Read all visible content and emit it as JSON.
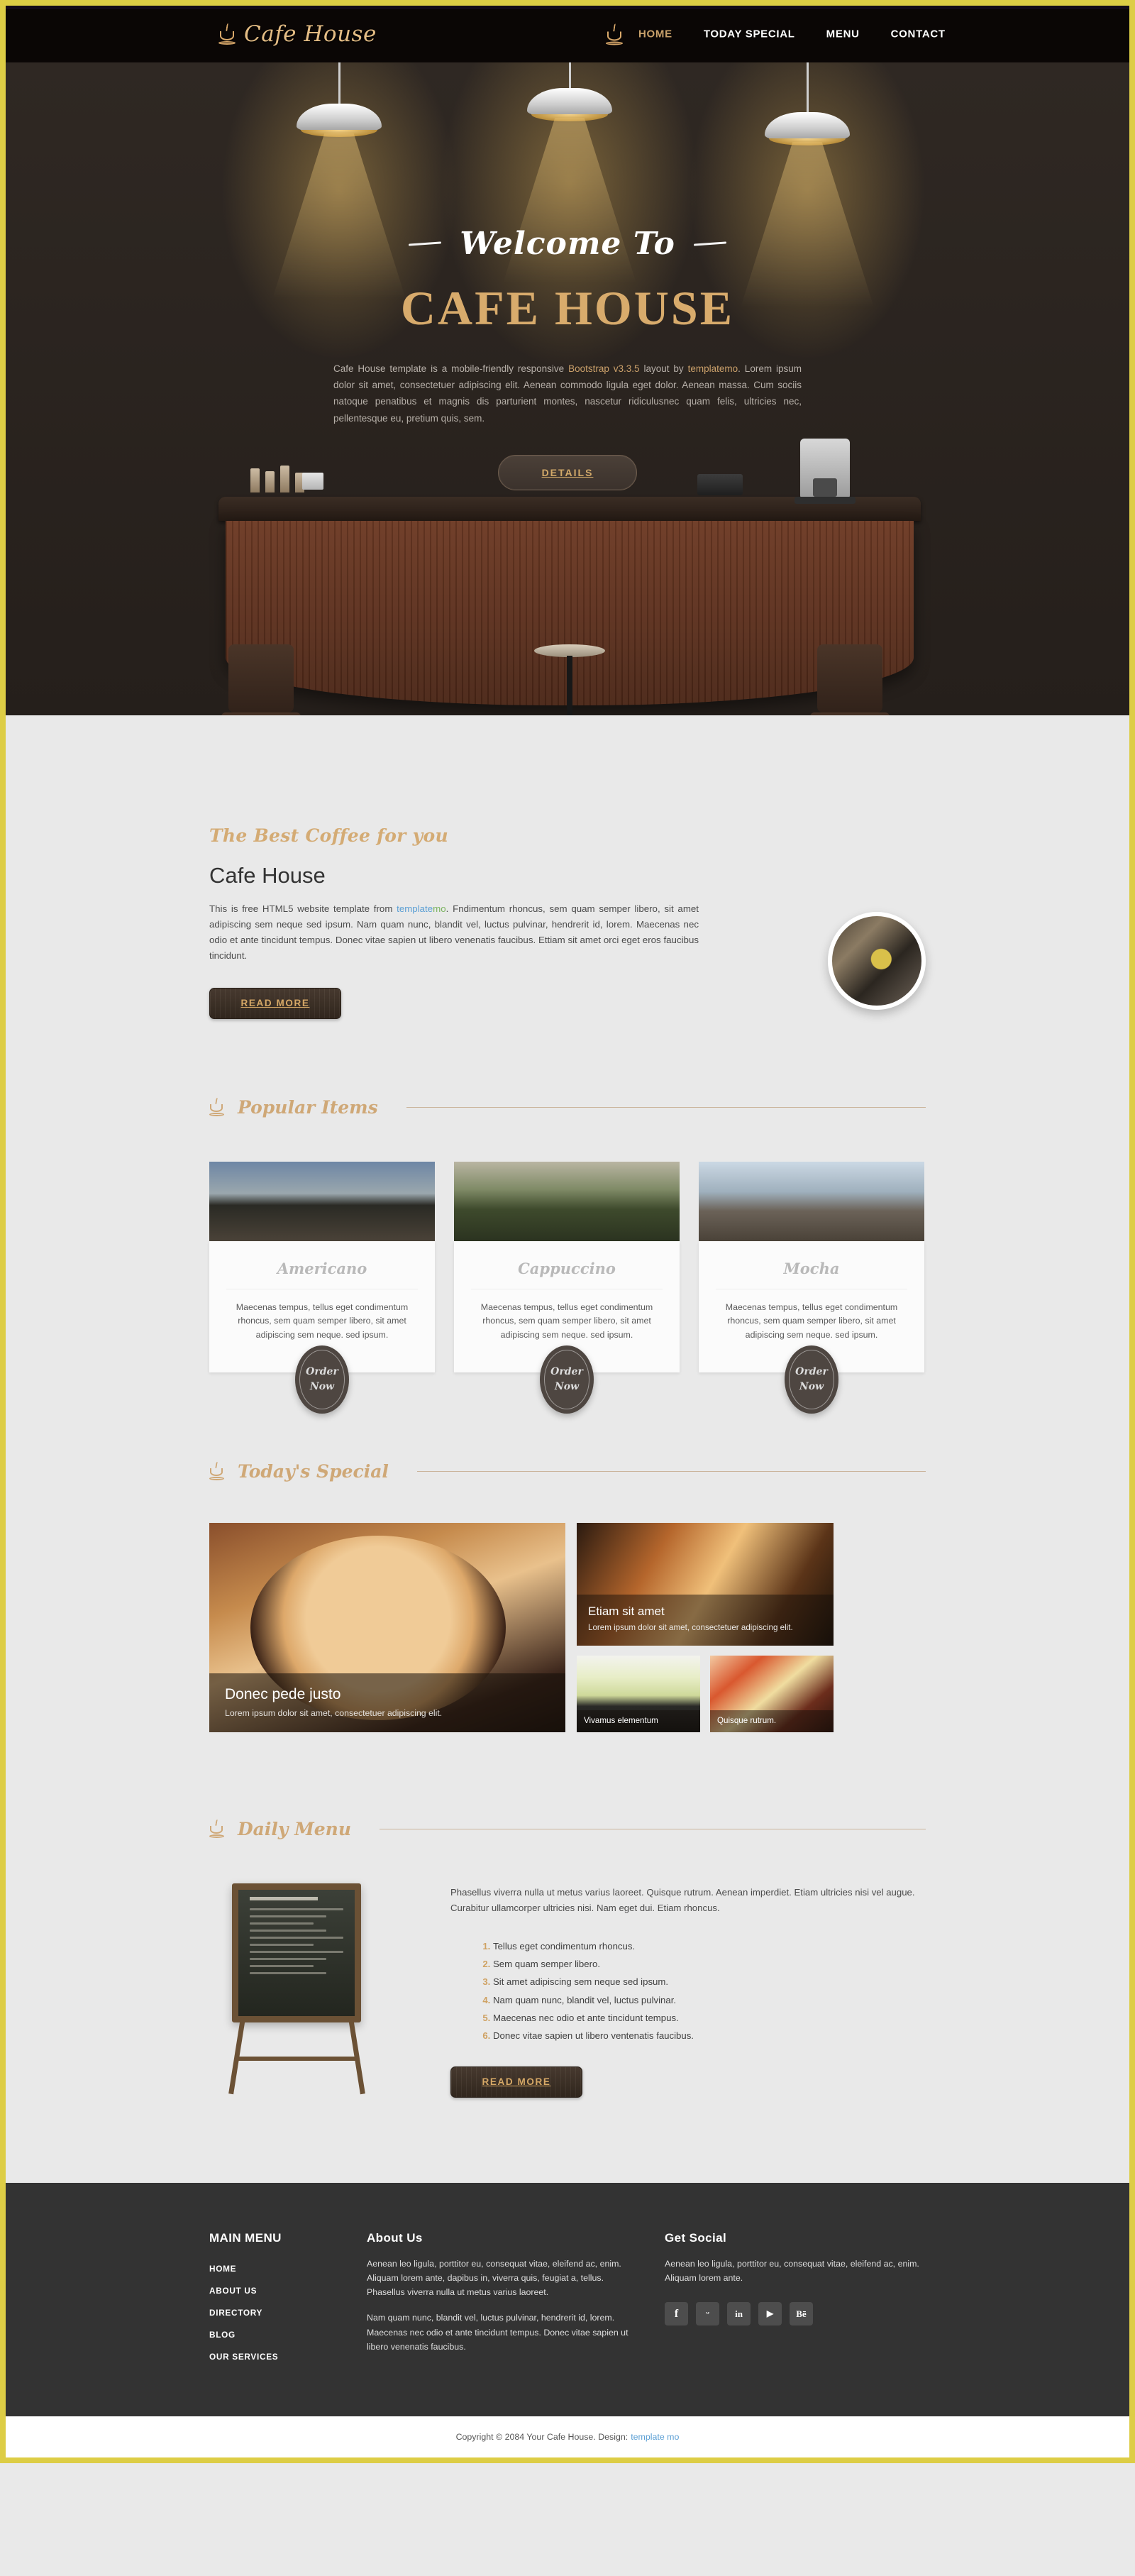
{
  "brand": {
    "name": "Cafe House",
    "icon": "coffee-cup-icon"
  },
  "nav": {
    "items": [
      {
        "label": "HOME",
        "active": true
      },
      {
        "label": "TODAY SPECIAL",
        "active": false
      },
      {
        "label": "MENU",
        "active": false
      },
      {
        "label": "CONTACT",
        "active": false
      }
    ]
  },
  "hero": {
    "welcome": "Welcome To",
    "title": "CAFE HOUSE",
    "description_pre": "Cafe House template is a mobile-friendly responsive ",
    "description_hl1": "Bootstrap v3.3.5",
    "description_mid": " layout by ",
    "description_hl2": "templatemo",
    "description_post": ". Lorem ipsum dolor sit amet, consectetuer adipiscing elit. Aenean commodo ligula eget dolor. Aenean massa. Cum sociis natoque penatibus et magnis dis parturient montes, nascetur ridiculusnec quam felis, ultricies nec, pellentesque eu, pretium quis, sem.",
    "button": "DETAILS"
  },
  "about": {
    "script_title": "The Best Coffee for you",
    "heading": "Cafe House",
    "body_pre": "This is free HTML5 website template from ",
    "link_text": "template",
    "link_text2": "mo",
    "body_post": ". Fndimentum rhoncus, sem quam semper libero, sit amet adipiscing sem neque sed ipsum. Nam quam nunc, blandit vel, luctus pulvinar, hendrerit id, lorem. Maecenas nec odio et ante tincidunt tempus. Donec vitae sapien ut libero venenatis faucibus. Ettiam sit amet orci eget eros faucibus tincidunt.",
    "button": "READ MORE"
  },
  "popular": {
    "heading": "Popular Items",
    "order_label_line1": "Order",
    "order_label_line2": "Now",
    "items": [
      {
        "name": "Americano",
        "desc": "Maecenas tempus, tellus eget condimentum rhoncus, sem quam semper libero, sit amet adipiscing sem neque. sed ipsum."
      },
      {
        "name": "Cappuccino",
        "desc": "Maecenas tempus, tellus eget condimentum rhoncus, sem quam semper libero, sit amet adipiscing sem neque. sed ipsum."
      },
      {
        "name": "Mocha",
        "desc": "Maecenas tempus, tellus eget condimentum rhoncus, sem quam semper libero, sit amet adipiscing sem neque. sed ipsum."
      }
    ]
  },
  "today": {
    "heading": "Today's Special",
    "main": {
      "title": "Donec pede justo",
      "desc": "Lorem ipsum dolor sit amet, consectetuer adipiscing elit."
    },
    "secondary": {
      "title": "Etiam sit amet",
      "desc": "Lorem ipsum dolor sit amet, consectetuer adipiscing elit."
    },
    "mini": [
      {
        "label": "Vivamus elementum"
      },
      {
        "label": "Quisque rutrum."
      }
    ]
  },
  "daily": {
    "heading": "Daily Menu",
    "intro": "Phasellus viverra nulla ut metus varius laoreet. Quisque rutrum. Aenean imperdiet. Etiam ultricies nisi vel augue. Curabitur ullamcorper ultricies nisi. Nam eget dui. Etiam rhoncus.",
    "list": [
      "Tellus eget condimentum rhoncus.",
      "Sem quam semper libero.",
      "Sit amet adipiscing sem neque sed ipsum.",
      "Nam quam nunc, blandit vel, luctus pulvinar.",
      "Maecenas nec odio et ante tincidunt tempus.",
      "Donec vitae sapien ut libero ventenatis faucibus."
    ],
    "button": "READ MORE"
  },
  "footer": {
    "menu_heading": "MAIN MENU",
    "menu_items": [
      "HOME",
      "ABOUT US",
      "DIRECTORY",
      "BLOG",
      "OUR SERVICES"
    ],
    "about_heading": "About Us",
    "about_p1": "Aenean leo ligula, porttitor eu, consequat vitae, eleifend ac, enim. Aliquam lorem ante, dapibus in, viverra quis, feugiat a, tellus. Phasellus viverra nulla ut metus varius laoreet.",
    "about_p2": "Nam quam nunc, blandit vel, luctus pulvinar, hendrerit id, lorem. Maecenas nec odio et ante tincidunt tempus. Donec vitae sapien ut libero venenatis faucibus.",
    "social_heading": "Get Social",
    "social_text": "Aenean leo ligula, porttitor eu, consequat vitae, eleifend ac, enim. Aliquam lorem ante.",
    "socials": [
      {
        "name": "facebook-icon",
        "glyph": "f"
      },
      {
        "name": "twitter-icon",
        "glyph": "ᵕ"
      },
      {
        "name": "linkedin-icon",
        "glyph": "in"
      },
      {
        "name": "youtube-icon",
        "glyph": "▶"
      },
      {
        "name": "behance-icon",
        "glyph": "Bē"
      }
    ]
  },
  "copyright": {
    "text": "Copyright © 2084 Your Cafe House. Design:",
    "link": "template mo"
  },
  "colors": {
    "accent_gold": "#d8ab6c",
    "page_border": "#ddcd45",
    "dark_bg": "#2e2722",
    "footer_bg": "#333333",
    "body_bg": "#e9e9e9"
  }
}
